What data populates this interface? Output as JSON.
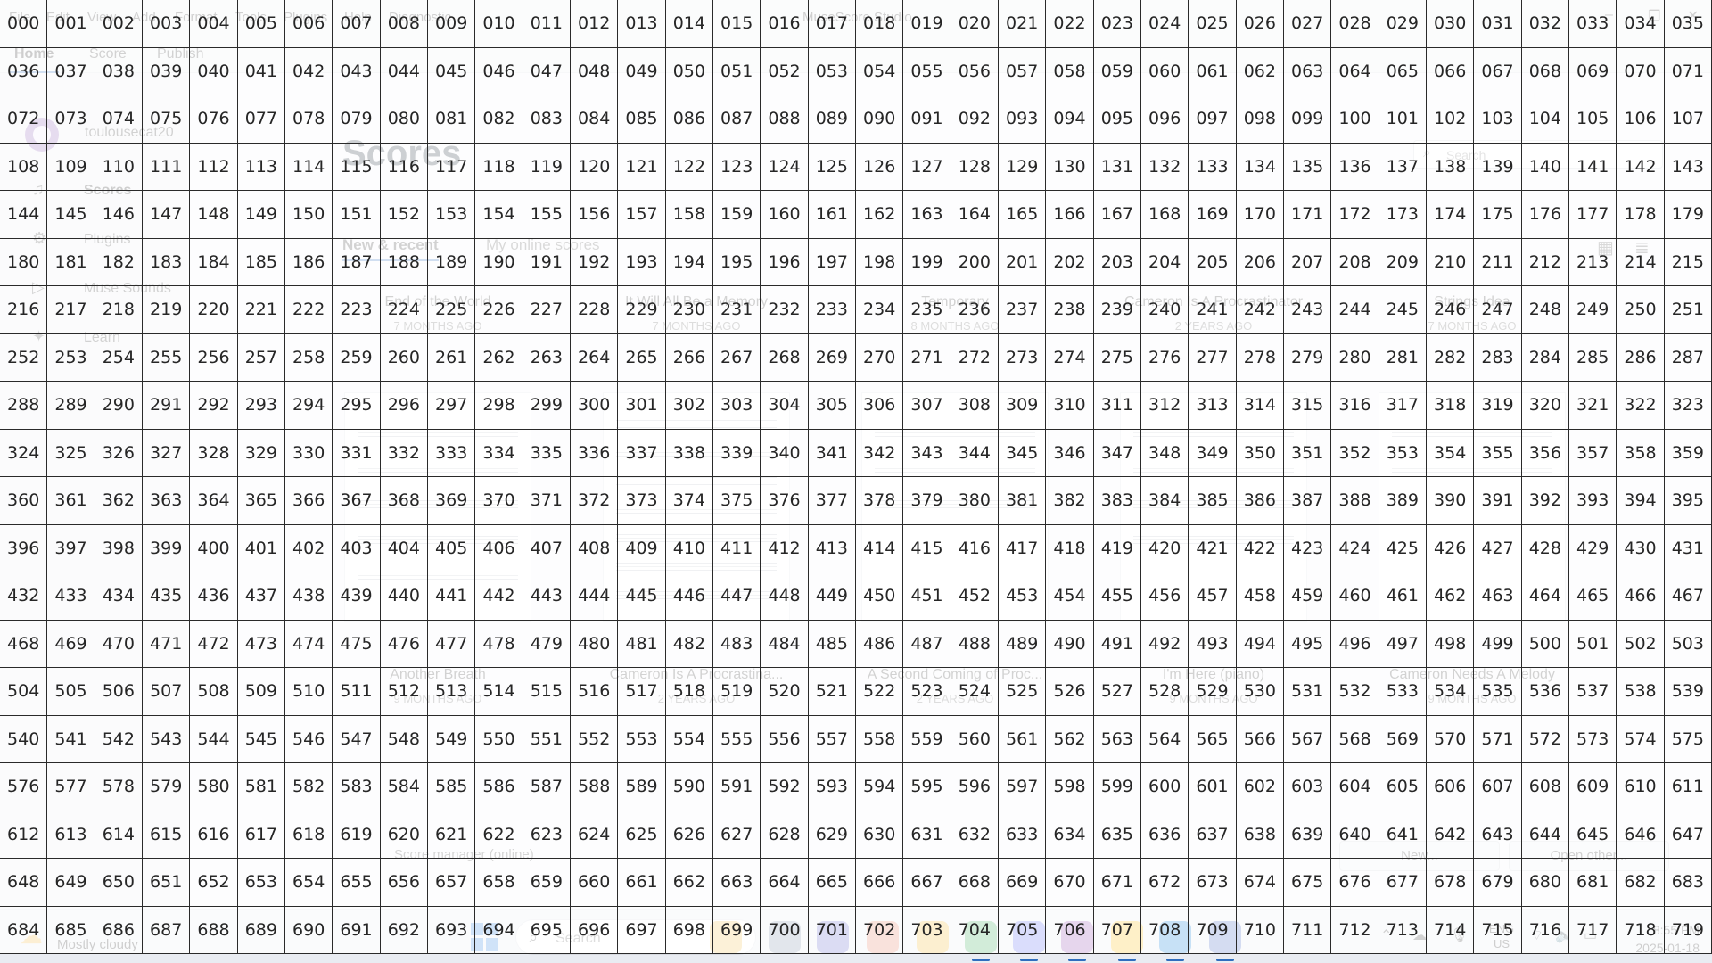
{
  "window": {
    "title": "MuseScore Studio",
    "menu": [
      "File",
      "Edit",
      "View",
      "Add",
      "Format",
      "Tools",
      "Plugins",
      "Help",
      "Diagnostic"
    ],
    "controls": [
      "–",
      "❐",
      "✕"
    ]
  },
  "tabs": [
    "Home",
    "Score",
    "Publish"
  ],
  "sidebar": {
    "username": "toulousecat20",
    "items": [
      {
        "label": "Scores",
        "icon": "♫"
      },
      {
        "label": "Plugins",
        "icon": "⚙"
      },
      {
        "label": "Muse Sounds",
        "icon": "▷"
      },
      {
        "label": "Learn",
        "icon": "✦"
      }
    ]
  },
  "main": {
    "title": "Scores",
    "search_placeholder": "Search",
    "subtabs": [
      "New & recent",
      "My online scores"
    ],
    "view_icons": [
      "▦",
      "≣"
    ],
    "scores_row1": [
      {
        "name": "End of the World",
        "time": "7 MONTHS AGO"
      },
      {
        "name": "It Will All Be a Memory",
        "time": "7 MONTHS AGO"
      },
      {
        "name": "Temporary",
        "time": "8 MONTHS AGO"
      },
      {
        "name": "Cameron Is A Procrastinator",
        "time": "2 YEARS AGO"
      },
      {
        "name": "Strings Idea",
        "time": "7 MONTHS AGO"
      }
    ],
    "scores_row2": [
      {
        "name": "Another Breath",
        "time": "9 MONTHS AGO"
      },
      {
        "name": "Cameron Is A Procrastina...",
        "time": "2 YEARS AGO"
      },
      {
        "name": "A Second Coming of Proc...",
        "time": "2 YEARS AGO"
      },
      {
        "name": "I'm Here (piano)",
        "time": "9 MONTHS AGO"
      },
      {
        "name": "Cameron Needs A Melody",
        "time": "9 MONTHS AGO"
      }
    ],
    "bottom": {
      "score_manager": "Score manager (online)",
      "new": "New...",
      "open_other": "Open other..."
    }
  },
  "taskbar": {
    "weather": "Mostly cloudy",
    "search": "Search",
    "lang_line1": "ENG",
    "lang_line2": "US",
    "time": "8:55 PM",
    "date": "2025-01-18",
    "apps": [
      {
        "name": "file-explorer",
        "color": "#f2c14e"
      },
      {
        "name": "photos",
        "color": "#7b8ea8"
      },
      {
        "name": "teams",
        "color": "#5b5fc7"
      },
      {
        "name": "copilot",
        "color": "#e27d60"
      },
      {
        "name": "folder",
        "color": "#f0b429"
      },
      {
        "name": "chrome",
        "color": "#34a853"
      },
      {
        "name": "discord",
        "color": "#5865f2"
      },
      {
        "name": "github-desktop",
        "color": "#8e44ad"
      },
      {
        "name": "chrome-profile",
        "color": "#fbbc05"
      },
      {
        "name": "vscode",
        "color": "#0078d4"
      },
      {
        "name": "musescore",
        "color": "#3d5fbf"
      }
    ]
  },
  "grid": {
    "columns": 36,
    "rows": 20
  }
}
